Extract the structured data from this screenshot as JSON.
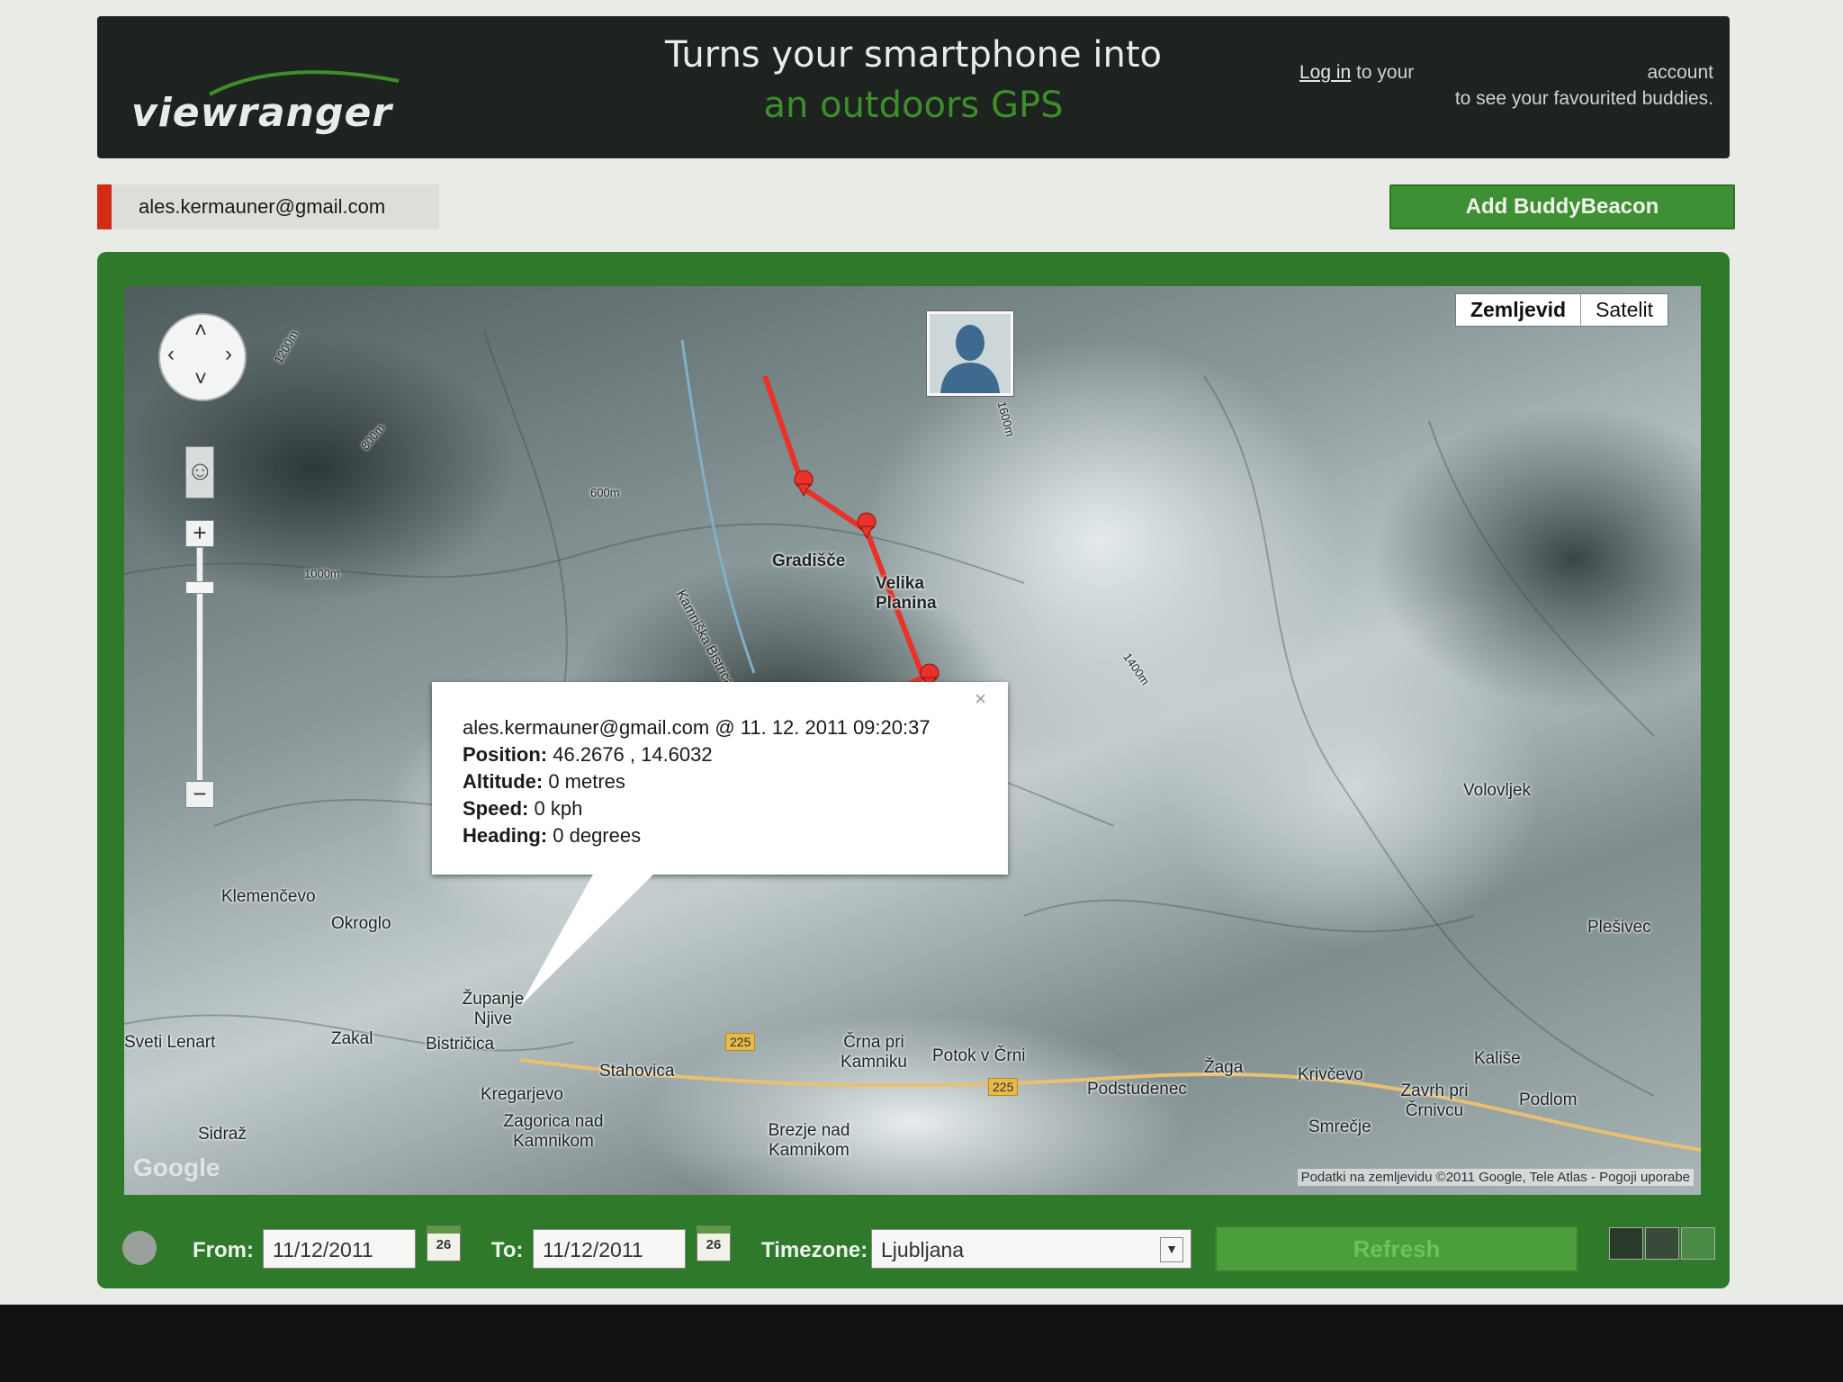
{
  "header": {
    "logo": "viewranger",
    "tagline_line1": "Turns your smartphone into",
    "tagline_line2": "an outdoors GPS",
    "login_link": "Log in",
    "login_text_1": "to your",
    "login_text_account": "account",
    "login_text_2": "to see your favourited buddies."
  },
  "user": {
    "email": "ales.kermauner@gmail.com"
  },
  "add_button": "Add BuddyBeacon",
  "map": {
    "types": [
      "Zemljevid",
      "Satelit"
    ],
    "active_type": "Zemljevid",
    "copyright": "Podatki na zemljevidu ©2011 Google, Tele Atlas - Pogoji uporabe",
    "google_logo": "Google",
    "places": [
      "Gradišče",
      "Velika Planina",
      "Klemenčevo",
      "Okroglo",
      "Županje Njive",
      "Sveti Lenart",
      "Zakal",
      "Bistričica",
      "Stahovica",
      "Kregarjevo",
      "Zagorica nad Kamnikom",
      "Črna pri Kamniku",
      "Potok v Črni",
      "Podstudenec",
      "Brezje nad Kamnikom",
      "Volovljek",
      "Plešivec",
      "Krivčevo",
      "Kališe",
      "Zavrh pri Črnivcu",
      "Smrečje",
      "Sidraž",
      "Podlom",
      "Žaga",
      "Kamniška Bistrica"
    ],
    "road_labels": [
      "225",
      "225"
    ],
    "contour_labels": [
      "1200m",
      "1600m",
      "800m",
      "600m",
      "1000m",
      "1400m"
    ]
  },
  "infowindow": {
    "header": "ales.kermauner@gmail.com @ 11. 12. 2011 09:20:37",
    "position_label": "Position:",
    "position_value": "46.2676 , 14.6032",
    "altitude_label": "Altitude:",
    "altitude_value": "0 metres",
    "speed_label": "Speed:",
    "speed_value": "0 kph",
    "heading_label": "Heading:",
    "heading_value": "0 degrees",
    "close": "×"
  },
  "controls": {
    "from_label": "From:",
    "from_value": "11/12/2011",
    "to_label": "To:",
    "to_value": "11/12/2011",
    "calendar_day": "26",
    "timezone_label": "Timezone:",
    "timezone_value": "Ljubljana",
    "refresh": "Refresh"
  },
  "colors": {
    "track": "#e8322a",
    "brand_green": "#3f8f34",
    "header_bg": "#1f2320"
  }
}
